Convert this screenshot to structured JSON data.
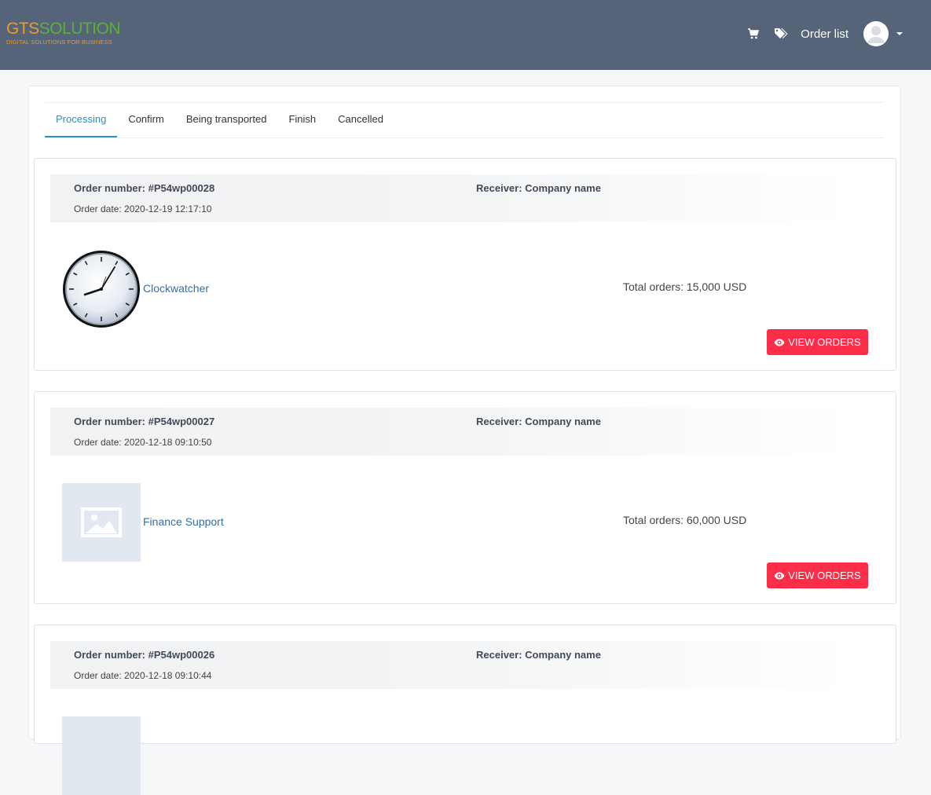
{
  "header": {
    "logo_gts": "GTS",
    "logo_solution": "SOLUTION",
    "logo_tagline": "DIGITAL SOLUTIONS FOR BUSINESS",
    "cart_icon": "cart-icon",
    "tags_icon": "tags-icon",
    "order_list_label": "Order list",
    "avatar_icon": "user-avatar-icon"
  },
  "tabs": [
    {
      "label": "Processing",
      "active": true
    },
    {
      "label": "Confirm"
    },
    {
      "label": "Being transported"
    },
    {
      "label": "Finish"
    },
    {
      "label": "Cancelled"
    }
  ],
  "orders": [
    {
      "order_number": "Order number: #P54wp00028",
      "order_date": "Order date: 2020-12-19 12:17:10",
      "receiver": "Receiver: Company name",
      "product_name": "Clockwatcher",
      "thumbnail": "clock-image",
      "total": "Total orders: 15,000 USD",
      "button": "VIEW ORDERS"
    },
    {
      "order_number": "Order number: #P54wp00027",
      "order_date": "Order date: 2020-12-18 09:10:50",
      "receiver": "Receiver: Company name",
      "product_name": "Finance Support",
      "thumbnail": "image-placeholder-icon",
      "total": "Total orders: 60,000 USD",
      "button": "VIEW ORDERS"
    },
    {
      "order_number": "Order number: #P54wp00026",
      "order_date": "Order date: 2020-12-18 09:10:44",
      "receiver": "Receiver: Company name"
    }
  ],
  "colors": {
    "header_bg": "#566479",
    "accent_tab": "#2a90c6",
    "button_bg": "#fb2d48",
    "link": "#356fa6"
  }
}
